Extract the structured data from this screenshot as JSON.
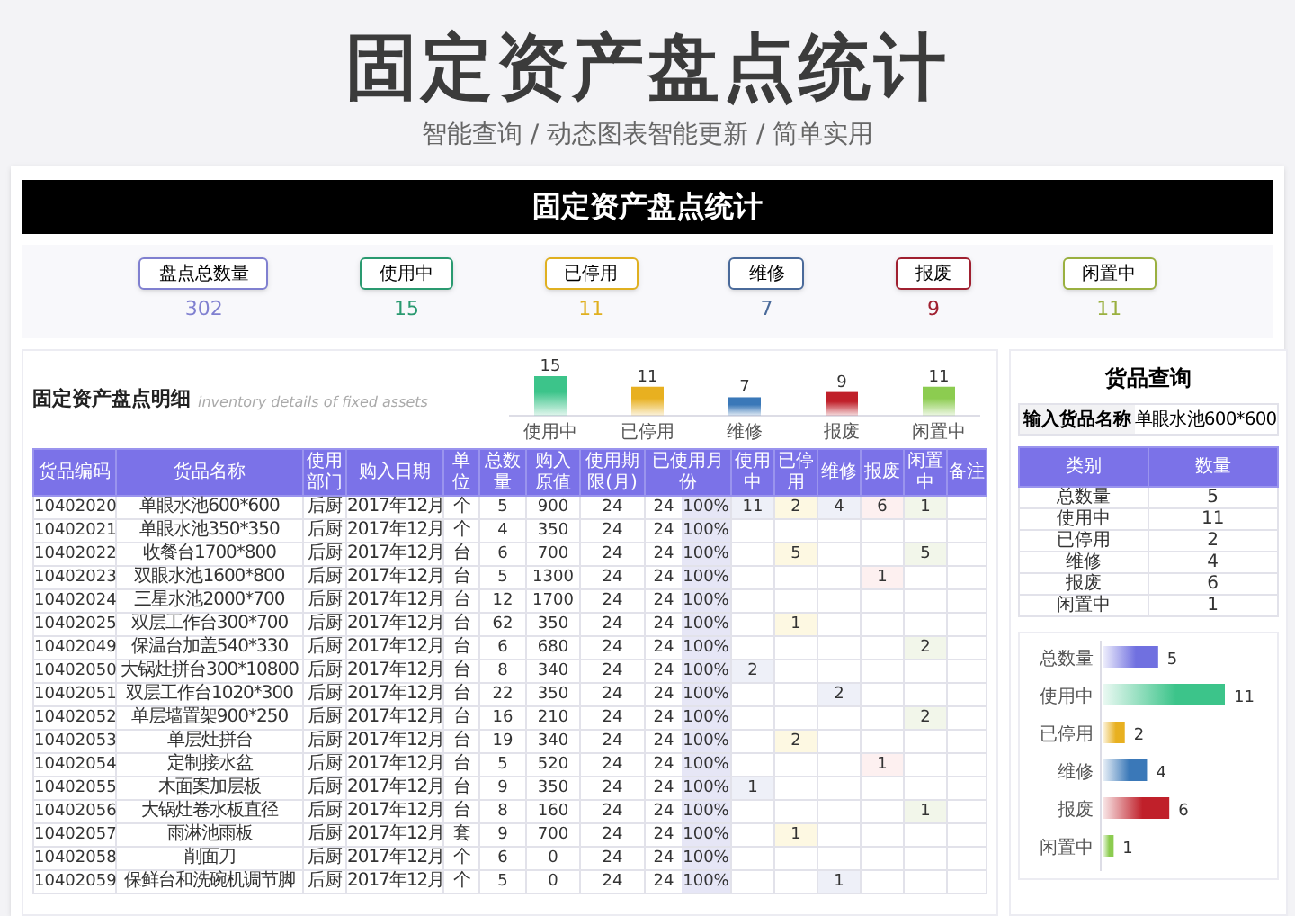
{
  "header": {
    "title": "固定资产盘点统计",
    "subtitle": "智能查询 / 动态图表智能更新 / 简单实用"
  },
  "banner": {
    "title": "固定资产盘点统计"
  },
  "summary": [
    {
      "label": "盘点总数量",
      "value": "302",
      "color": "#8080d0"
    },
    {
      "label": "使用中",
      "value": "15",
      "color": "#2a9a70"
    },
    {
      "label": "已停用",
      "value": "11",
      "color": "#e0b020"
    },
    {
      "label": "维修",
      "value": "7",
      "color": "#4a6a9a"
    },
    {
      "label": "报废",
      "value": "9",
      "color": "#a02030"
    },
    {
      "label": "闲置中",
      "value": "11",
      "color": "#9ab040"
    }
  ],
  "detail": {
    "title": "固定资产盘点明细",
    "subtitle": "inventory details of fixed assets",
    "chart_data": {
      "type": "bar",
      "orientation": "vertical",
      "categories": [
        "使用中",
        "已停用",
        "维修",
        "报废",
        "闲置中"
      ],
      "data_labels": true,
      "values": [
        15,
        11,
        7,
        9,
        11
      ]
    },
    "bar_colors": [
      {
        "color": "#3cc48a"
      },
      {
        "color": "#e8b020"
      },
      {
        "color": "#3a78b8"
      },
      {
        "color": "#c0202a"
      },
      {
        "color": "#8ccc50"
      }
    ],
    "table": {
      "columns": [
        "货品编码",
        "货品名称",
        "使用部门",
        "购入日期",
        "单位",
        "总数量",
        "购入原值",
        "使用期限(月)",
        "已使用月份",
        "使用中",
        "已停用",
        "维修",
        "报废",
        "闲置中",
        "备注"
      ],
      "rows": [
        {
          "cells": [
            "10402020",
            "单眼水池600*600",
            "后厨",
            "2017年12月",
            "个",
            "5",
            "900",
            "24",
            {
              "months": "24",
              "share": "100%"
            },
            "11",
            "2",
            "4",
            "6",
            "1",
            ""
          ]
        },
        {
          "cells": [
            "10402021",
            "单眼水池350*350",
            "后厨",
            "2017年12月",
            "个",
            "4",
            "350",
            "24",
            {
              "months": "24",
              "share": "100%"
            },
            "",
            "",
            "",
            "",
            "",
            ""
          ]
        },
        {
          "cells": [
            "10402022",
            "收餐台1700*800",
            "后厨",
            "2017年12月",
            "台",
            "6",
            "700",
            "24",
            {
              "months": "24",
              "share": "100%"
            },
            "",
            "5",
            "",
            "",
            "5",
            ""
          ]
        },
        {
          "cells": [
            "10402023",
            "双眼水池1600*800",
            "后厨",
            "2017年12月",
            "台",
            "5",
            "1300",
            "24",
            {
              "months": "24",
              "share": "100%"
            },
            "",
            "",
            "",
            "1",
            "",
            ""
          ]
        },
        {
          "cells": [
            "10402024",
            "三星水池2000*700",
            "后厨",
            "2017年12月",
            "台",
            "12",
            "1700",
            "24",
            {
              "months": "24",
              "share": "100%"
            },
            "",
            "",
            "",
            "",
            "",
            ""
          ]
        },
        {
          "cells": [
            "10402025",
            "双层工作台300*700",
            "后厨",
            "2017年12月",
            "台",
            "62",
            "350",
            "24",
            {
              "months": "24",
              "share": "100%"
            },
            "",
            "1",
            "",
            "",
            "",
            ""
          ]
        },
        {
          "cells": [
            "10402049",
            "保温台加盖540*330",
            "后厨",
            "2017年12月",
            "台",
            "6",
            "680",
            "24",
            {
              "months": "24",
              "share": "100%"
            },
            "",
            "",
            "",
            "",
            "2",
            ""
          ]
        },
        {
          "cells": [
            "10402050",
            "大锅灶拼台300*10800",
            "后厨",
            "2017年12月",
            "台",
            "8",
            "340",
            "24",
            {
              "months": "24",
              "share": "100%"
            },
            "2",
            "",
            "",
            "",
            "",
            ""
          ]
        },
        {
          "cells": [
            "10402051",
            "双层工作台1020*300",
            "后厨",
            "2017年12月",
            "台",
            "22",
            "350",
            "24",
            {
              "months": "24",
              "share": "100%"
            },
            "",
            "",
            "2",
            "",
            "",
            ""
          ]
        },
        {
          "cells": [
            "10402052",
            "单层墙置架900*250",
            "后厨",
            "2017年12月",
            "台",
            "16",
            "210",
            "24",
            {
              "months": "24",
              "share": "100%"
            },
            "",
            "",
            "",
            "",
            "2",
            ""
          ]
        },
        {
          "cells": [
            "10402053",
            "单层灶拼台",
            "后厨",
            "2017年12月",
            "台",
            "19",
            "340",
            "24",
            {
              "months": "24",
              "share": "100%"
            },
            "",
            "2",
            "",
            "",
            "",
            ""
          ]
        },
        {
          "cells": [
            "10402054",
            "定制接水盆",
            "后厨",
            "2017年12月",
            "台",
            "5",
            "520",
            "24",
            {
              "months": "24",
              "share": "100%"
            },
            "",
            "",
            "",
            "1",
            "",
            ""
          ]
        },
        {
          "cells": [
            "10402055",
            "木面案加层板",
            "后厨",
            "2017年12月",
            "台",
            "9",
            "350",
            "24",
            {
              "months": "24",
              "share": "100%"
            },
            "1",
            "",
            "",
            "",
            "",
            ""
          ]
        },
        {
          "cells": [
            "10402056",
            "大锅灶卷水板直径",
            "后厨",
            "2017年12月",
            "台",
            "8",
            "160",
            "24",
            {
              "months": "24",
              "share": "100%"
            },
            "",
            "",
            "",
            "",
            "1",
            ""
          ]
        },
        {
          "cells": [
            "10402057",
            "雨淋池雨板",
            "后厨",
            "2017年12月",
            "套",
            "9",
            "700",
            "24",
            {
              "months": "24",
              "share": "100%"
            },
            "",
            "1",
            "",
            "",
            "",
            ""
          ]
        },
        {
          "cells": [
            "10402058",
            "削面刀",
            "后厨",
            "2017年12月",
            "个",
            "6",
            "0",
            "24",
            {
              "months": "24",
              "share": "100%"
            },
            "",
            "",
            "",
            "",
            "",
            ""
          ]
        },
        {
          "cells": [
            "10402059",
            "保鲜台和洗碗机调节脚",
            "后厨",
            "2017年12月",
            "个",
            "5",
            "0",
            "24",
            {
              "months": "24",
              "share": "100%"
            },
            "",
            "",
            "1",
            "",
            "",
            ""
          ]
        }
      ]
    }
  },
  "query": {
    "title": "货品查询",
    "search": {
      "label": "输入货品名称",
      "value": "单眼水池600*600"
    },
    "table": {
      "columns": [
        "类别",
        "数量"
      ],
      "rows": [
        [
          "总数量",
          "5"
        ],
        [
          "使用中",
          "11"
        ],
        [
          "已停用",
          "2"
        ],
        [
          "维修",
          "4"
        ],
        [
          "报废",
          "6"
        ],
        [
          "闲置中",
          "1"
        ]
      ]
    },
    "chart_data": {
      "type": "bar",
      "orientation": "horizontal",
      "data_labels": true,
      "categories": [
        "总数量",
        "使用中",
        "已停用",
        "维修",
        "报废",
        "闲置中"
      ],
      "values": [
        5,
        11,
        2,
        4,
        6,
        1
      ]
    },
    "bar_colors": [
      {
        "color": "#7070e0"
      },
      {
        "color": "#3cc48a"
      },
      {
        "color": "#e8b020"
      },
      {
        "color": "#3a78b8"
      },
      {
        "color": "#c0202a"
      },
      {
        "color": "#8ccc50"
      }
    ]
  }
}
